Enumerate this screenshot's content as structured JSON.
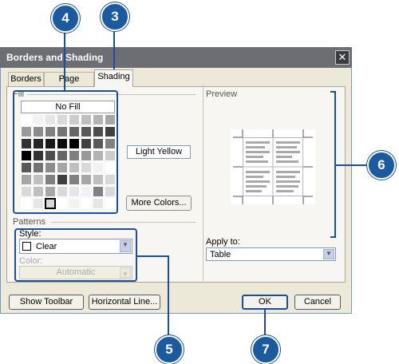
{
  "window": {
    "title": "Borders and Shading",
    "close_label": "✕"
  },
  "tabs": [
    {
      "label": "Borders",
      "active": false
    },
    {
      "label": "Page Border",
      "active": false
    },
    {
      "label": "Shading",
      "active": true
    }
  ],
  "fill": {
    "section_label": "Fill",
    "no_fill_label": "No Fill",
    "selected_name": "Light Yellow",
    "more_colors_label": "More Colors...",
    "swatches": [
      "#ffffff",
      "#f2f2f2",
      "#e6e6e6",
      "#d9d9d9",
      "#cccccc",
      "#bfbfbf",
      "#b3b3b3",
      "#a6a6a6",
      "#999999",
      "#8c8c8c",
      "#808080",
      "#737373",
      "#666666",
      "#595959",
      "#4d4d4d",
      "#404040",
      "#333333",
      "#262626",
      "#1a1a1a",
      "#0d0d0d",
      "#000000",
      "#404040",
      "#595959",
      "#808080",
      "#000000",
      "#333333",
      "#4d4d4d",
      "#666666",
      "#808080",
      "#999999",
      "#b3b3b3",
      "#cccccc",
      "#595959",
      "#737373",
      "#8c8c8c",
      "#a6a6a6",
      "#bfbfbf",
      "#d9d9d9",
      "#f2f2f2",
      "#ffffff",
      "#a6a6a6",
      "#bfbfbf",
      "#808080",
      "#404040",
      "#808080",
      "#a6a6a6",
      "#bfbfbf",
      "#d9d9d9",
      "#d9d9d9",
      "#bfbfbf",
      "#a6a6a6",
      "#d9d9d9",
      "#e6e6e6",
      "#f2f2f2",
      "#808080",
      "#d9d9d9",
      "#ffffff",
      "#e6e6e6",
      "#d9d9d9",
      "#ffffff",
      "#f2f2f2",
      "#ffffff",
      "#e6e6e6",
      "#ffffff"
    ]
  },
  "patterns": {
    "section_label": "Patterns",
    "style_label": "Style:",
    "style_value": "Clear",
    "color_label": "Color:",
    "color_value": "Automatic"
  },
  "preview": {
    "section_label": "Preview"
  },
  "apply_to": {
    "label": "Apply to:",
    "value": "Table"
  },
  "buttons": {
    "show_toolbar": "Show Toolbar",
    "horizontal_line": "Horizontal Line...",
    "ok": "OK",
    "cancel": "Cancel"
  },
  "callouts": [
    "3",
    "4",
    "5",
    "6",
    "7"
  ],
  "colors": {
    "callout_blue": "#1b5a9e",
    "dialog_face": "#ece9d8"
  }
}
